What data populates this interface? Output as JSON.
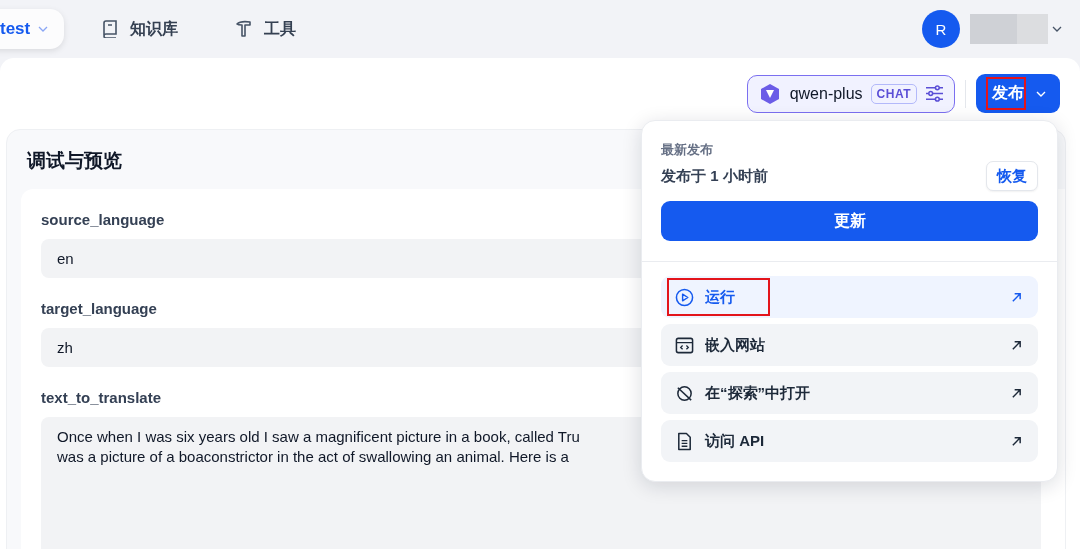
{
  "nav": {
    "app": {
      "label": "test"
    },
    "items": [
      {
        "kind": "book",
        "label": "知识库"
      },
      {
        "kind": "hammer",
        "label": "工具"
      }
    ],
    "user": {
      "avatar": "R"
    }
  },
  "toolbar": {
    "model": {
      "name": "qwen-plus",
      "badge": "CHAT"
    },
    "publish": {
      "label": "发布",
      "highlighted": true
    }
  },
  "panel": {
    "title": "调试与预览",
    "fields": [
      {
        "label": "source_language",
        "lines": [
          "en"
        ]
      },
      {
        "label": "target_language",
        "lines": [
          "zh"
        ]
      },
      {
        "label": "text_to_translate",
        "lines": [
          "Once when I was six years old I saw a magnificent picture in a book, called Tru",
          "was a picture of a boaconstrictor in the act of swallowing an animal. Here is a"
        ]
      }
    ]
  },
  "publish_menu": {
    "heading": "最新发布",
    "status": "发布于 1 小时前",
    "restore": "恢复",
    "update": "更新",
    "items": [
      {
        "kind": "play",
        "label": "运行",
        "selected": true,
        "highlighted": true
      },
      {
        "kind": "embed",
        "label": "嵌入网站",
        "selected": false,
        "highlighted": false
      },
      {
        "kind": "explore",
        "label": "在“探索”中打开",
        "selected": false,
        "highlighted": false
      },
      {
        "kind": "doc",
        "label": "访问 API",
        "selected": false,
        "highlighted": false
      }
    ]
  }
}
